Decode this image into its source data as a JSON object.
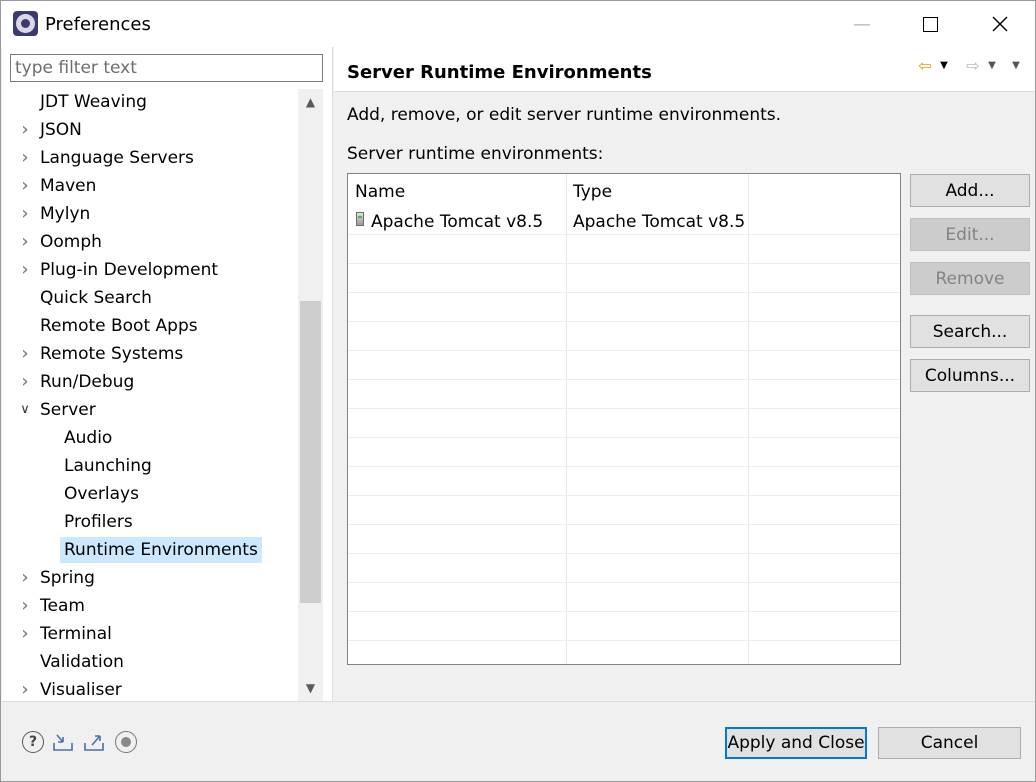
{
  "window": {
    "title": "Preferences"
  },
  "filter": {
    "placeholder": "type filter text"
  },
  "tree": [
    {
      "label": "JDT Weaving",
      "level": 0,
      "expander": "none"
    },
    {
      "label": "JSON",
      "level": 0,
      "expander": "collapsed"
    },
    {
      "label": "Language Servers",
      "level": 0,
      "expander": "collapsed"
    },
    {
      "label": "Maven",
      "level": 0,
      "expander": "collapsed"
    },
    {
      "label": "Mylyn",
      "level": 0,
      "expander": "collapsed"
    },
    {
      "label": "Oomph",
      "level": 0,
      "expander": "collapsed"
    },
    {
      "label": "Plug-in Development",
      "level": 0,
      "expander": "collapsed"
    },
    {
      "label": "Quick Search",
      "level": 0,
      "expander": "none"
    },
    {
      "label": "Remote Boot Apps",
      "level": 0,
      "expander": "none"
    },
    {
      "label": "Remote Systems",
      "level": 0,
      "expander": "collapsed"
    },
    {
      "label": "Run/Debug",
      "level": 0,
      "expander": "collapsed"
    },
    {
      "label": "Server",
      "level": 0,
      "expander": "expanded"
    },
    {
      "label": "Audio",
      "level": 1,
      "expander": "none"
    },
    {
      "label": "Launching",
      "level": 1,
      "expander": "none"
    },
    {
      "label": "Overlays",
      "level": 1,
      "expander": "none"
    },
    {
      "label": "Profilers",
      "level": 1,
      "expander": "none"
    },
    {
      "label": "Runtime Environments",
      "level": 1,
      "expander": "none",
      "selected": true
    },
    {
      "label": "Spring",
      "level": 0,
      "expander": "collapsed"
    },
    {
      "label": "Team",
      "level": 0,
      "expander": "collapsed"
    },
    {
      "label": "Terminal",
      "level": 0,
      "expander": "collapsed"
    },
    {
      "label": "Validation",
      "level": 0,
      "expander": "none"
    },
    {
      "label": "Visualiser",
      "level": 0,
      "expander": "collapsed"
    }
  ],
  "page": {
    "title": "Server Runtime Environments",
    "description": "Add, remove, or edit server runtime environments.",
    "list_label": "Server runtime environments:"
  },
  "table": {
    "headers": [
      "Name",
      "Type"
    ],
    "rows": [
      {
        "name": "Apache Tomcat v8.5",
        "type": "Apache Tomcat v8.5"
      }
    ]
  },
  "buttons": {
    "add": "Add...",
    "edit": "Edit...",
    "remove": "Remove",
    "search": "Search...",
    "columns": "Columns..."
  },
  "footer": {
    "apply_close": "Apply and Close",
    "cancel": "Cancel"
  },
  "icons": {
    "help": "help-icon",
    "import": "import-icon",
    "export": "export-icon",
    "oomph": "oomph-record-icon"
  },
  "colors": {
    "selection": "#cce8ff",
    "default_button_border": "#0078d7"
  }
}
